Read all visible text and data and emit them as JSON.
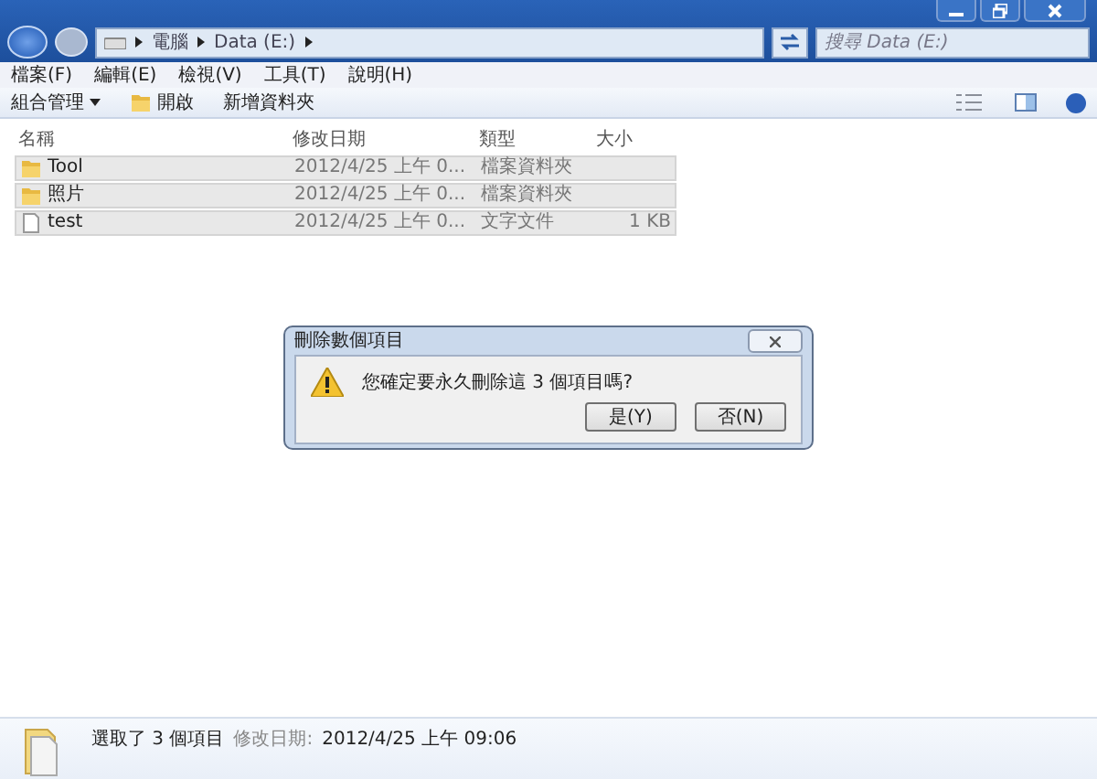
{
  "address_bar": {
    "crumbs": [
      "電腦",
      "Data (E:)"
    ]
  },
  "search": {
    "placeholder": "搜尋 Data (E:)"
  },
  "menu": [
    "檔案(F)",
    "編輯(E)",
    "檢視(V)",
    "工具(T)",
    "說明(H)"
  ],
  "toolbar": [
    {
      "label": "組合管理",
      "kind": "dropdown"
    },
    {
      "label": "開啟",
      "kind": "open"
    },
    {
      "label": "新增資料夾",
      "kind": "plain"
    }
  ],
  "table": {
    "columns": [
      "名稱",
      "修改日期",
      "類型",
      "大小"
    ],
    "rows": [
      {
        "kind": "folder",
        "name": "Tool",
        "modified": "2012/4/25 上午 0...",
        "type": "檔案資料夾",
        "selected": true
      },
      {
        "kind": "folder",
        "name": "照片",
        "modified": "2012/4/25 上午 0...",
        "type": "檔案資料夾",
        "selected": true
      },
      {
        "kind": "file",
        "name": "test",
        "modified": "2012/4/25 上午 0...",
        "type": "文字文件",
        "size": "1 KB",
        "selected": true
      }
    ]
  },
  "dialog": {
    "title": "刪除數個項目",
    "message": "您確定要永久刪除這 3 個項目嗎?",
    "buttons": [
      "是(Y)",
      "否(N)"
    ]
  },
  "status_bar": {
    "selection": "選取了 3 個項目",
    "label": "修改日期:",
    "value": "2012/4/25 上午 09:06"
  }
}
